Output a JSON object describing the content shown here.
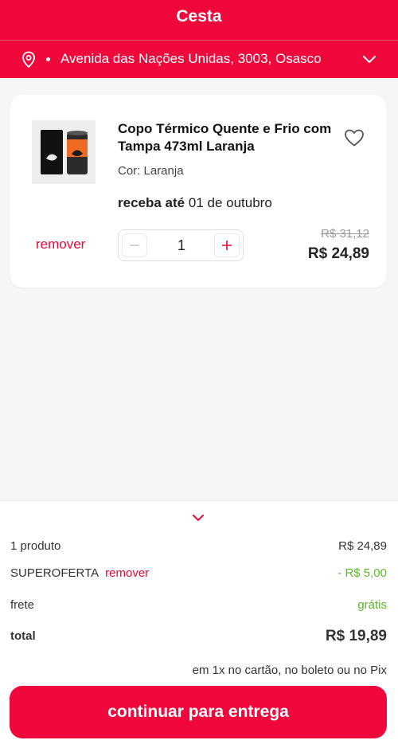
{
  "header": {
    "title": "Cesta",
    "address": "Avenida das Nações Unidas, 3003, Osasco",
    "pin_icon": "map-pin-icon",
    "dropdown_icon": "chevron-down-icon"
  },
  "cart_item": {
    "name": "Copo Térmico Quente e Frio com Tampa 473ml Laranja",
    "variant": "Cor: Laranja",
    "delivery_label": "receba até",
    "delivery_date": "01 de outubro",
    "remove_label": "remover",
    "quantity": "1",
    "old_price": "R$ 31,12",
    "price": "R$ 24,89",
    "favorite_icon": "heart-icon"
  },
  "summary": {
    "products_label": "1 produto",
    "products_value": "R$ 24,89",
    "promo_label": "SUPEROFERTA",
    "promo_remove": "remover",
    "promo_value": "- R$ 5,00",
    "shipping_label": "frete",
    "shipping_value": "grátis",
    "total_label": "total",
    "total_value": "R$ 19,89",
    "payment_note": "em 1x no cartão, no boleto ou no Pix",
    "cta_label": "continuar para entrega"
  },
  "colors": {
    "brand": "#f0073b",
    "discount": "#5db82e",
    "link": "#e00b3a"
  }
}
